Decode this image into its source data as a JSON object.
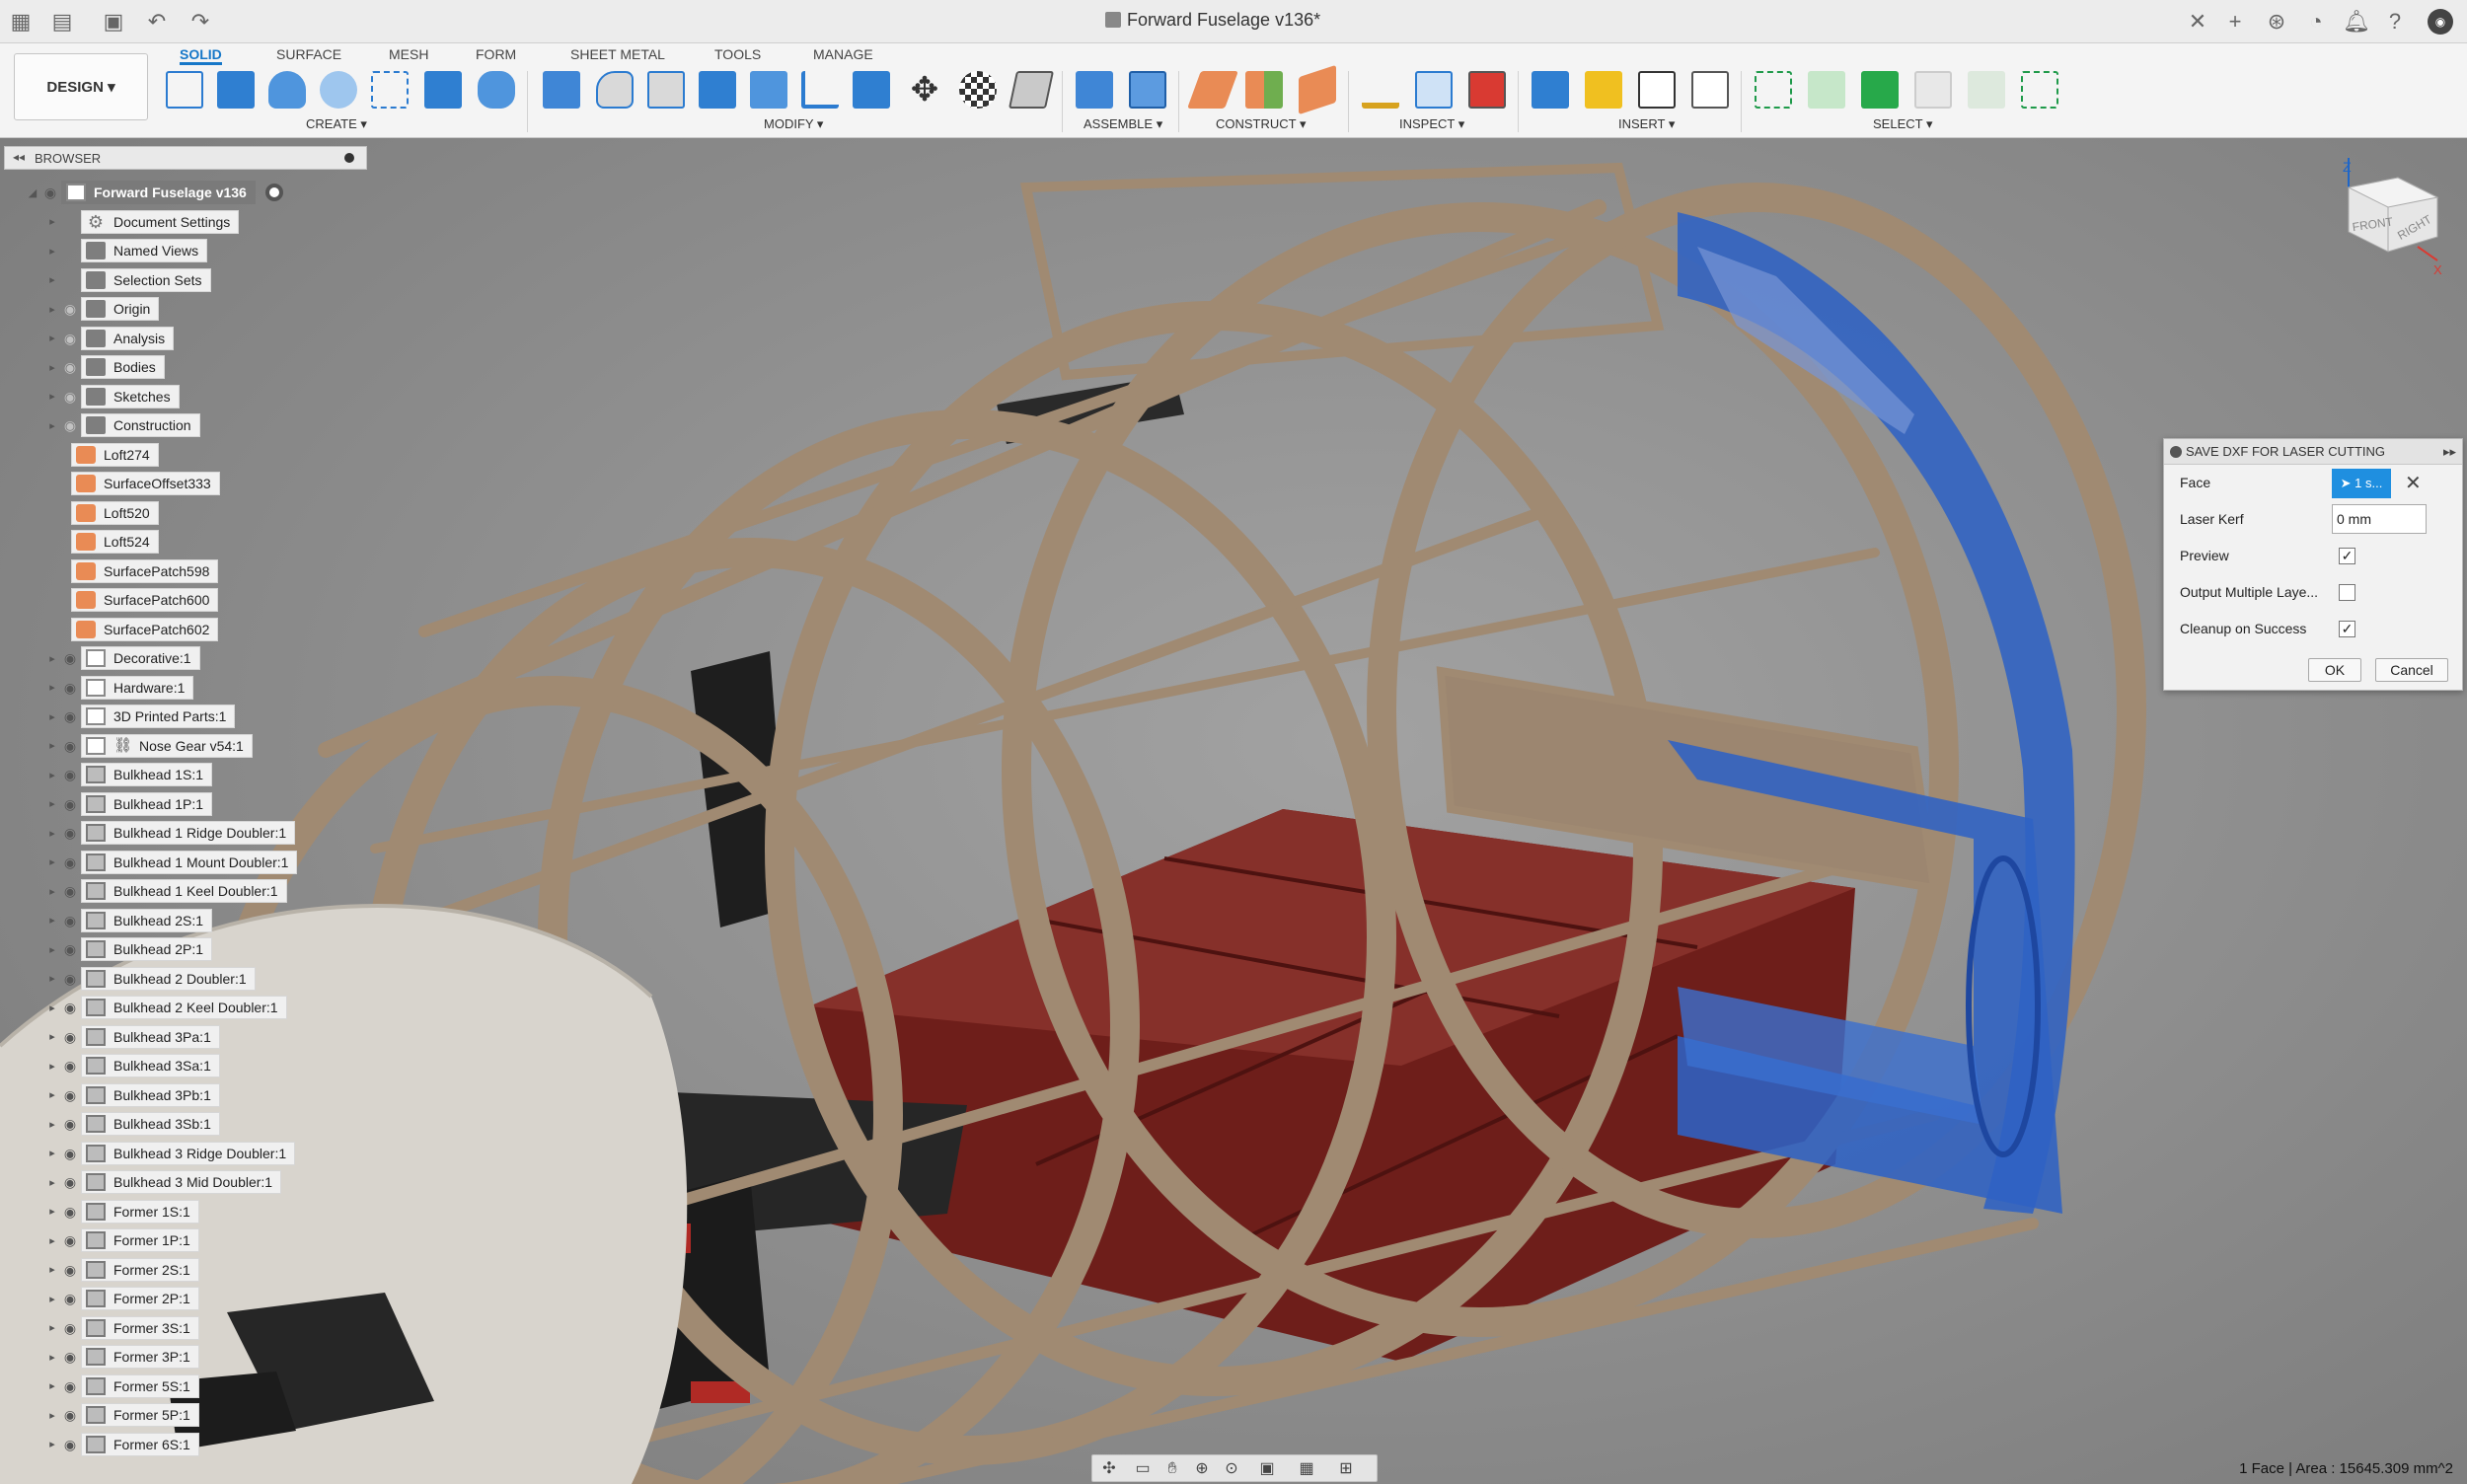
{
  "titlebar": {
    "document_title": "Forward Fuselage v136*"
  },
  "ribbon": {
    "workspace_button": "DESIGN ▾",
    "tabs": [
      "SOLID",
      "SURFACE",
      "MESH",
      "FORM",
      "SHEET METAL",
      "TOOLS",
      "MANAGE"
    ],
    "groups": [
      "CREATE ▾",
      "MODIFY ▾",
      "ASSEMBLE ▾",
      "CONSTRUCT ▾",
      "INSPECT ▾",
      "INSERT ▾",
      "SELECT ▾"
    ]
  },
  "browser": {
    "header": "BROWSER",
    "root": "Forward Fuselage v136",
    "items": [
      {
        "label": "Document Settings",
        "icon": "gear-icon"
      },
      {
        "label": "Named Views",
        "icon": "folder-icon"
      },
      {
        "label": "Selection Sets",
        "icon": "folder-icon"
      },
      {
        "label": "Origin",
        "icon": "folder-icon"
      },
      {
        "label": "Analysis",
        "icon": "folder-icon"
      },
      {
        "label": "Bodies",
        "icon": "folder-icon"
      },
      {
        "label": "Sketches",
        "icon": "folder-icon"
      },
      {
        "label": "Construction",
        "icon": "folder-icon"
      },
      {
        "label": "Loft274",
        "icon": "surface-feature-icon"
      },
      {
        "label": "SurfaceOffset333",
        "icon": "surface-feature-icon"
      },
      {
        "label": "Loft520",
        "icon": "surface-feature-icon"
      },
      {
        "label": "Loft524",
        "icon": "surface-feature-icon"
      },
      {
        "label": "SurfacePatch598",
        "icon": "surface-feature-icon"
      },
      {
        "label": "SurfacePatch600",
        "icon": "surface-feature-icon"
      },
      {
        "label": "SurfacePatch602",
        "icon": "surface-feature-icon"
      },
      {
        "label": "Decorative:1",
        "icon": "component-icon"
      },
      {
        "label": "Hardware:1",
        "icon": "component-icon"
      },
      {
        "label": "3D Printed Parts:1",
        "icon": "component-icon"
      },
      {
        "label": "Nose Gear v54:1",
        "icon": "linked-component-icon"
      },
      {
        "label": "Bulkhead 1S:1",
        "icon": "body-icon"
      },
      {
        "label": "Bulkhead 1P:1",
        "icon": "body-icon"
      },
      {
        "label": "Bulkhead 1 Ridge Doubler:1",
        "icon": "body-icon"
      },
      {
        "label": "Bulkhead 1 Mount Doubler:1",
        "icon": "body-icon"
      },
      {
        "label": "Bulkhead 1 Keel Doubler:1",
        "icon": "body-icon"
      },
      {
        "label": "Bulkhead 2S:1",
        "icon": "body-icon"
      },
      {
        "label": "Bulkhead 2P:1",
        "icon": "body-icon"
      },
      {
        "label": "Bulkhead 2 Doubler:1",
        "icon": "body-icon"
      },
      {
        "label": "Bulkhead 2 Keel Doubler:1",
        "icon": "body-icon"
      },
      {
        "label": "Bulkhead 3Pa:1",
        "icon": "body-icon"
      },
      {
        "label": "Bulkhead 3Sa:1",
        "icon": "body-icon"
      },
      {
        "label": "Bulkhead 3Pb:1",
        "icon": "body-icon"
      },
      {
        "label": "Bulkhead 3Sb:1",
        "icon": "body-icon"
      },
      {
        "label": "Bulkhead 3 Ridge Doubler:1",
        "icon": "body-icon"
      },
      {
        "label": "Bulkhead 3 Mid Doubler:1",
        "icon": "body-icon"
      },
      {
        "label": "Former 1S:1",
        "icon": "body-icon"
      },
      {
        "label": "Former 1P:1",
        "icon": "body-icon"
      },
      {
        "label": "Former 2S:1",
        "icon": "body-icon"
      },
      {
        "label": "Former 2P:1",
        "icon": "body-icon"
      },
      {
        "label": "Former 3S:1",
        "icon": "body-icon"
      },
      {
        "label": "Former 3P:1",
        "icon": "body-icon"
      },
      {
        "label": "Former 5S:1",
        "icon": "body-icon"
      },
      {
        "label": "Former 5P:1",
        "icon": "body-icon"
      },
      {
        "label": "Former 6S:1",
        "icon": "body-icon"
      }
    ]
  },
  "dialog": {
    "title": "SAVE DXF FOR LASER CUTTING",
    "face_label": "Face",
    "face_value": "1 s...",
    "kerf_label": "Laser Kerf",
    "kerf_value": "0 mm",
    "preview_label": "Preview",
    "preview_checked": true,
    "multi_label": "Output Multiple Laye...",
    "multi_checked": false,
    "cleanup_label": "Cleanup on Success",
    "cleanup_checked": true,
    "ok": "OK",
    "cancel": "Cancel"
  },
  "viewcube": {
    "front": "FRONT",
    "right": "RIGHT",
    "z_axis": "Z",
    "x_axis": "X"
  },
  "status": {
    "selection_info": "1 Face | Area : 15645.309 mm^2"
  },
  "colors": {
    "accent": "#1677c8",
    "selection_blue": "#2f62c4",
    "plywood": "#a08a72",
    "battery_red": "#6e1e1a"
  }
}
